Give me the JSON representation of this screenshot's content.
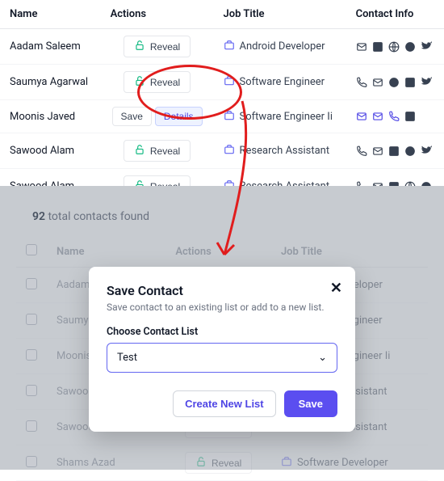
{
  "headers": {
    "name": "Name",
    "actions": "Actions",
    "job": "Job Title",
    "contact": "Contact Info"
  },
  "buttons": {
    "reveal": "Reveal",
    "save": "Save",
    "details": "Details",
    "createList": "Create New List",
    "saveModal": "Save"
  },
  "rows": [
    {
      "name": "Aadam Saleem",
      "job": "Android Developer",
      "mode": "reveal"
    },
    {
      "name": "Saumya Agarwal",
      "job": "Software Engineer",
      "mode": "reveal"
    },
    {
      "name": "Moonis Javed",
      "job": "Software Engineer Ii",
      "mode": "save"
    },
    {
      "name": "Sawood Alam",
      "job": "Research Assistant",
      "mode": "reveal"
    },
    {
      "name": "Sawood Alam",
      "job": "Research Assistant",
      "mode": "reveal"
    }
  ],
  "total": {
    "count": "92",
    "label": "total contacts found"
  },
  "fadedHeaders": {
    "name": "Name",
    "actions": "Actions",
    "job": "Job Title"
  },
  "fadedRows": [
    {
      "name": "Aadam Saleem",
      "job": "Android Developer"
    },
    {
      "name": "Saumya Agarwal",
      "job": "Software Engineer"
    },
    {
      "name": "Moonis Javed",
      "job": "Software Engineer Ii"
    },
    {
      "name": "Sawood Alam",
      "job": "Research Assistant"
    },
    {
      "name": "Sawood Alam",
      "job": "Research Assistant"
    },
    {
      "name": "Shams Azad",
      "job": "Software Developer"
    }
  ],
  "modal": {
    "title": "Save Contact",
    "sub": "Save contact to an existing list or add to a new list.",
    "label": "Choose Contact List",
    "selected": "Test"
  }
}
